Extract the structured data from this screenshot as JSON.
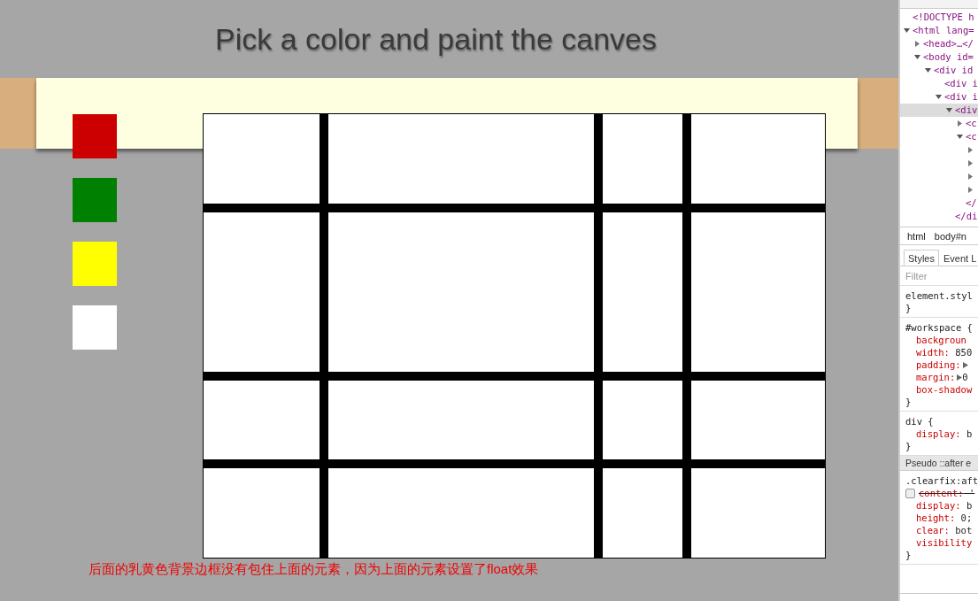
{
  "page": {
    "title": "Pick a color and paint the canves",
    "palette": [
      {
        "color": "#cc0000"
      },
      {
        "color": "#008000"
      },
      {
        "color": "#ffff00"
      },
      {
        "color": "#ffffff"
      }
    ],
    "note": "后面的乳黄色背景边框没有包住上面的元素，因为上面的元素设置了float效果"
  },
  "devtools": {
    "tree": [
      {
        "text": "<!DOCTYPE h"
      },
      {
        "text": "<html lang=",
        "expanded": true,
        "children": [
          {
            "text": "<head>…</",
            "expanded": false
          },
          {
            "text": "<body id=",
            "expanded": true,
            "children": [
              {
                "text": "<div id",
                "expanded": true,
                "children": [
                  {
                    "text": "<div i"
                  },
                  {
                    "text": "<div i",
                    "expanded": true,
                    "children": [
                      {
                        "text": "<div",
                        "expanded": true,
                        "selected": true,
                        "closing": "</di",
                        "children": [
                          {
                            "text": "<c",
                            "expanded": false
                          },
                          {
                            "text": "<c",
                            "expanded": true,
                            "closing": "</",
                            "children": [
                              {
                                "expanded": false
                              },
                              {
                                "expanded": false
                              },
                              {
                                "expanded": false
                              },
                              {
                                "expanded": false
                              }
                            ]
                          }
                        ]
                      }
                    ]
                  }
                ]
              }
            ]
          }
        ]
      }
    ],
    "breadcrumbs": [
      "html",
      "body#n"
    ],
    "tabs": [
      {
        "label": "Styles",
        "selected": true
      },
      {
        "label": "Event L",
        "selected": false
      }
    ],
    "filter": {
      "placeholder": "Filter"
    },
    "rules": [
      {
        "selector": "element.styl",
        "close": "}"
      },
      {
        "selector": "#workspace {",
        "close": "}",
        "properties": [
          {
            "name": "backgroun"
          },
          {
            "name": "width:",
            "value": "850"
          },
          {
            "name": "padding:",
            "expandable": true
          },
          {
            "name": "margin:",
            "value": "0",
            "expandable": true
          },
          {
            "name": "box-shadow"
          }
        ]
      },
      {
        "selector": "div {",
        "close": "}",
        "properties": [
          {
            "name": "display:",
            "value": "b"
          }
        ]
      },
      {
        "header": "Pseudo ::after e",
        "selector": ".clearfix:aft",
        "close": "}",
        "properties": [
          {
            "name": "content:",
            "value": "'",
            "struck": true,
            "checked": false
          },
          {
            "name": "display:",
            "value": "b"
          },
          {
            "name": "height:",
            "value": "0;"
          },
          {
            "name": "clear:",
            "value": "bot"
          },
          {
            "name": "visibility"
          }
        ]
      }
    ]
  }
}
